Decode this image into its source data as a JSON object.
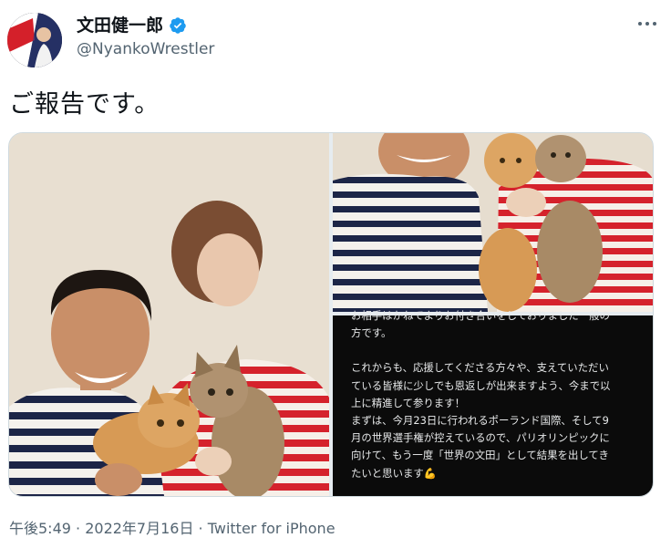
{
  "author": {
    "display_name": "文田健一郎",
    "handle": "@NyankoWrestler",
    "avatar_icon": "profile-photo",
    "verified_icon": "verified-badge-icon",
    "verified_color": "#1d9bf0"
  },
  "more_icon": "more-options-icon",
  "tweet": {
    "text": "ご報告です。"
  },
  "media": {
    "image_left": "photo-man-woman-two-cats",
    "image_right_top": "photo-closeup-cats-held",
    "image_right_bottom": "screenshot-text-note",
    "note_lines": [
      "お相手はかねてよりお付き合いをしておりました一般の",
      "方です。",
      "",
      "これからも、応援してくださる方々や、支えていただい",
      "ている皆様に少しでも恩返しが出来ますよう、今まで以",
      "上に精進して参ります！",
      "まずは、今月23日に行われるポーランド国際、そして9",
      "月の世界選手権が控えているので、パリオリンピックに",
      "向けて、もう一度「世界の文田」として結果を出してき",
      "たいと思います"
    ],
    "emoji": "💪"
  },
  "meta": {
    "time": "午後5:49",
    "date": "2022年7月16日",
    "source": "Twitter for iPhone",
    "separator": " · "
  },
  "colors": {
    "text": "#0f1419",
    "secondary": "#536471",
    "border": "#cfd9de"
  }
}
